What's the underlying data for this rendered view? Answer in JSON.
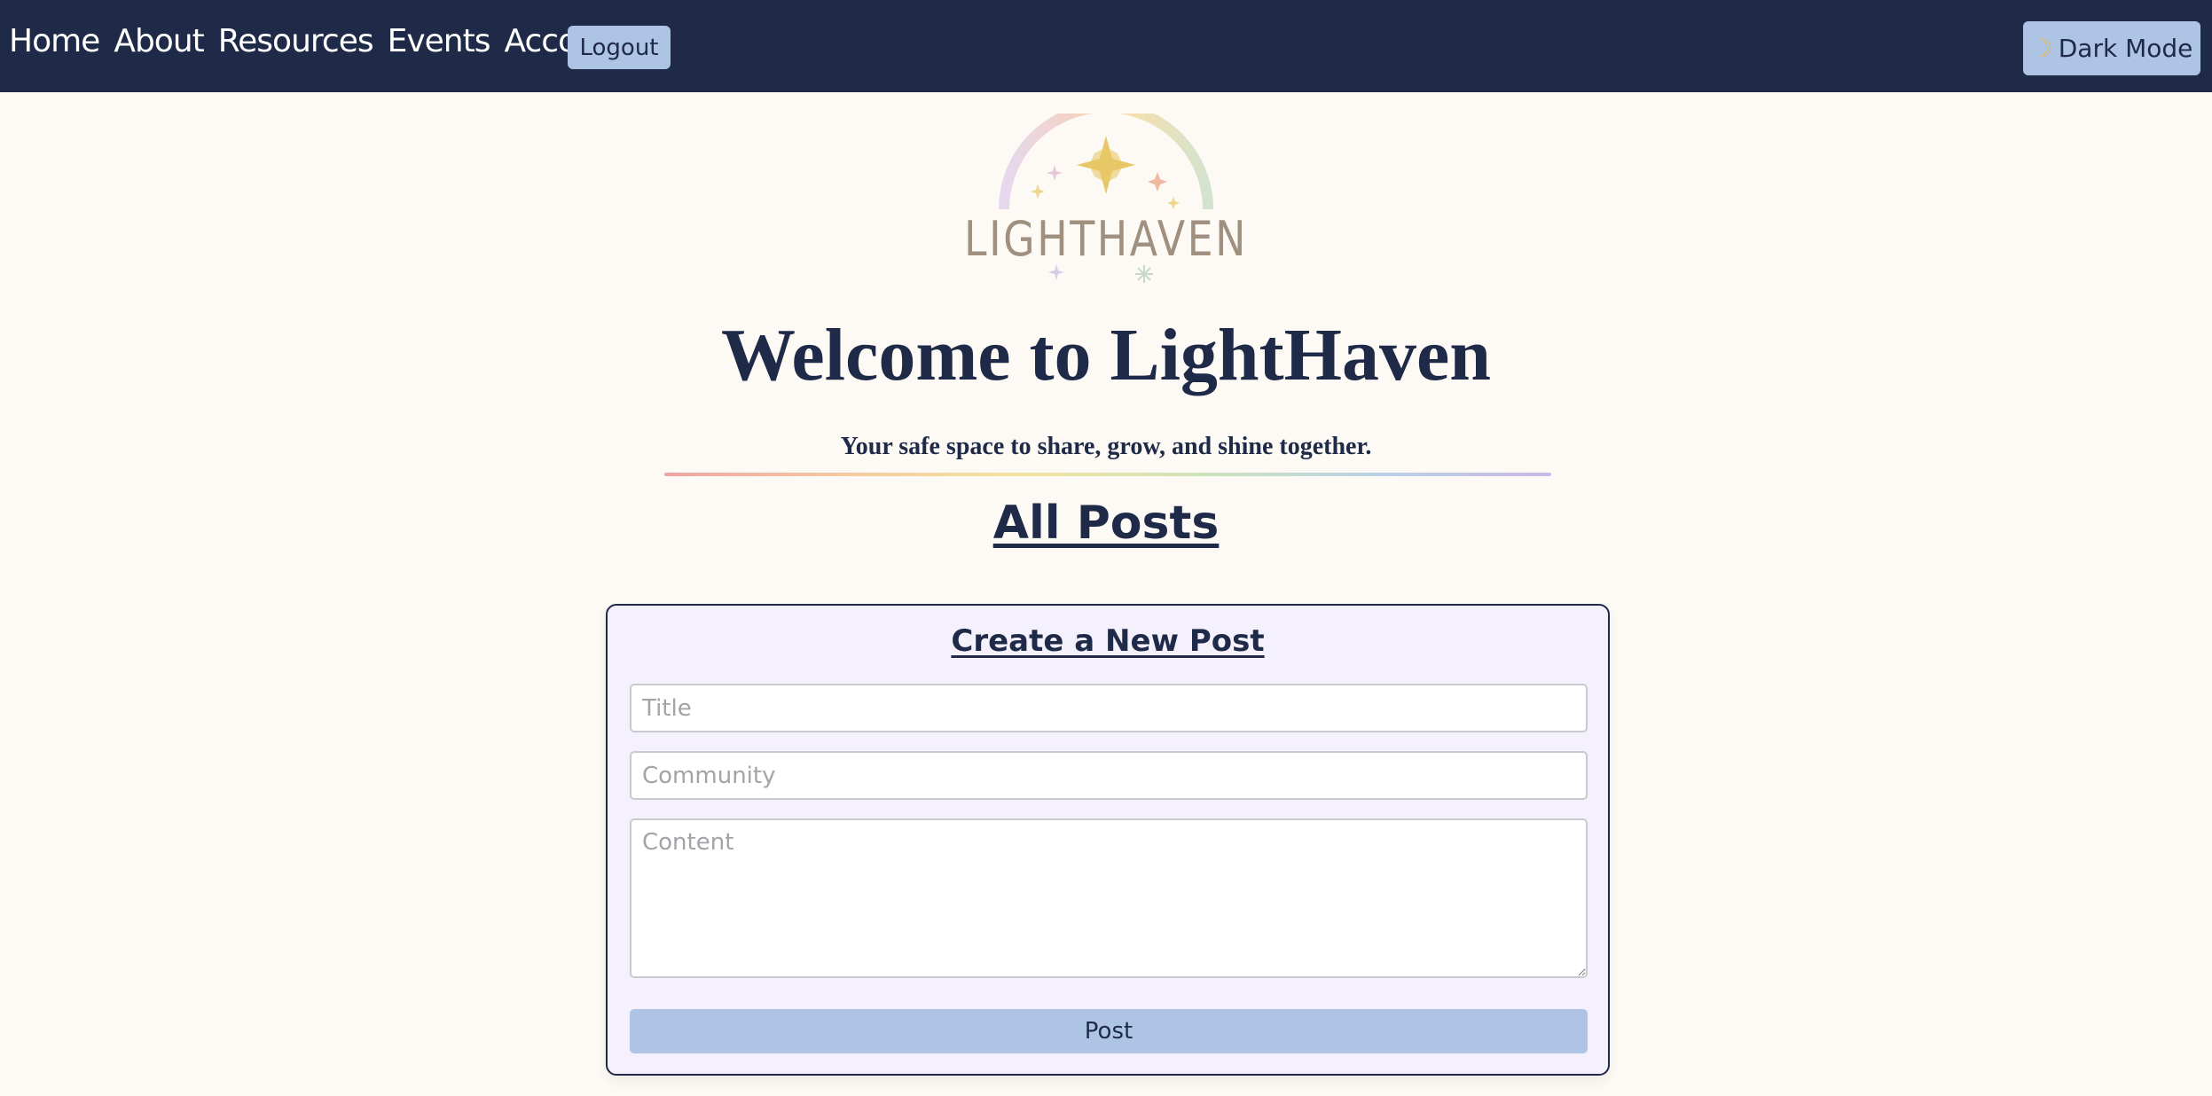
{
  "nav": {
    "links": [
      "Home",
      "About",
      "Resources",
      "Events",
      "Account"
    ],
    "logout_label": "Logout",
    "dark_mode_label": "Dark Mode",
    "dark_mode_icon": "moon-icon"
  },
  "logo": {
    "text": "LIGHTHAVEN"
  },
  "hero": {
    "title": "Welcome to LightHaven",
    "subtitle": "Your safe space to share, grow, and shine together."
  },
  "posts": {
    "section_title": "All Posts"
  },
  "create_post": {
    "title": "Create a New Post",
    "title_placeholder": "Title",
    "community_placeholder": "Community",
    "content_placeholder": "Content",
    "submit_label": "Post"
  },
  "colors": {
    "navbar": "#1e2a47",
    "accent_button": "#aec4e5",
    "page_background": "#fdf9f4",
    "card_background": "#f4f1fc"
  }
}
